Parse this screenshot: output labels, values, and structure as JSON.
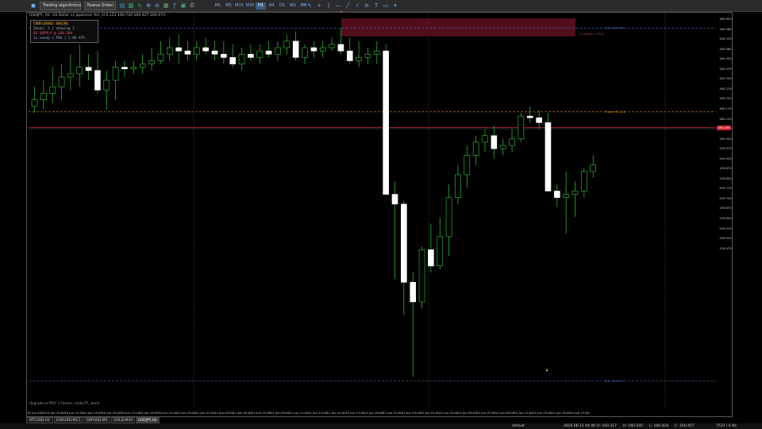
{
  "toolbar": {
    "algo_trading_label": "Trading algorítmico",
    "new_order_label": "Nueva Orden",
    "timeframes": [
      "M1",
      "M5",
      "M15",
      "M30",
      "H1",
      "H4",
      "D1",
      "W1",
      "MN"
    ],
    "active_timeframe": "H1"
  },
  "chart": {
    "title": "USDJPY, H1:  US Dollar vs Japanese Yen  ,H 0.123  160.726  160.427  160.473",
    "panel": {
      "title": "CONFLUENCE ENGINE",
      "zones": "Zones: 3 | showing 1",
      "active": "01 SUPPLY @ 160.584",
      "sweep": "   1x sweep + POH | 1.86 ATR"
    },
    "zone_label": "1x sweep + POH",
    "line_labels": {
      "top": "PDH 160.600",
      "mid": "Pivot 160.343",
      "bottom": "PDL 159.517"
    },
    "upgrade_text": "Upgrade to PRO: 5 factors, multi-TF, alerts",
    "current_price": "160.295",
    "price_labels": [
      "160.630",
      "160.580",
      "160.530",
      "160.480",
      "160.430",
      "160.370",
      "160.320",
      "160.270",
      "160.220",
      "160.170",
      "160.120",
      "160.070",
      "160.020",
      "159.970",
      "159.920",
      "159.870",
      "159.820",
      "159.770",
      "159.720",
      "159.670",
      "159.620",
      "159.570",
      "159.520",
      "159.470"
    ],
    "time_labels": [
      "10 Jun 2026",
      "10 Jun 10:00",
      "10 Jun 11:00",
      "10 Jun 13:00",
      "10 Jun 15:00",
      "10 Jun 17:00",
      "10 Jun 19:00",
      "10 Jun 21:00",
      "10 Jun 23:00",
      "11 Jun 01:00",
      "11 Jun 03:00",
      "11 Jun 05:00",
      "11 Jun 07:00",
      "11 Jun 09:00",
      "11 Jun 11:00",
      "11 Jun 13:00",
      "11 Jun 15:00",
      "11 Jun 17:00",
      "11 Jun 19:00",
      "11 Jun 21:00",
      "11 Jun 23:00",
      "12 Jun 01:00",
      "12 Jun 03:00",
      "12 Jun 05:00",
      "12 Jun 07:00",
      "12 Jun 09:00",
      "12 Jun 11:00",
      "12 Jun 13:00",
      "12 Jun 15:00",
      "12 Jun 17:00"
    ]
  },
  "tabs": [
    "BTCUSD,H1",
    "EURUSD,M15",
    "GBPUSD,M5",
    "GOLD,M30",
    "USDJPY,H1"
  ],
  "active_tab": "USDJPY,H1",
  "status": {
    "profile": "default",
    "datetime": "2026.06.11 04:00",
    "open": "O: 160.317",
    "high": "H: 160.545",
    "low": "L: 160.424",
    "close": "C: 160.457",
    "traffic": "7537 / 6 Kb"
  },
  "colors": {
    "bull": "#000000",
    "bear": "#ffffff",
    "wick": "#33cc33",
    "zone": "#5a0f1e",
    "level_top": "#4a6fb5",
    "level_mid": "#d88a1a",
    "level_price": "#cc2233"
  },
  "chart_data": {
    "type": "candlestick",
    "ylim": [
      159.46,
      160.64
    ],
    "candles": [
      {
        "o": 160.36,
        "h": 160.42,
        "l": 160.34,
        "c": 160.38
      },
      {
        "o": 160.38,
        "h": 160.44,
        "l": 160.35,
        "c": 160.4
      },
      {
        "o": 160.4,
        "h": 160.48,
        "l": 160.37,
        "c": 160.42
      },
      {
        "o": 160.42,
        "h": 160.49,
        "l": 160.38,
        "c": 160.45
      },
      {
        "o": 160.45,
        "h": 160.52,
        "l": 160.41,
        "c": 160.46
      },
      {
        "o": 160.46,
        "h": 160.55,
        "l": 160.42,
        "c": 160.48
      },
      {
        "o": 160.48,
        "h": 160.52,
        "l": 160.44,
        "c": 160.47
      },
      {
        "o": 160.47,
        "h": 160.53,
        "l": 160.4,
        "c": 160.41
      },
      {
        "o": 160.41,
        "h": 160.47,
        "l": 160.35,
        "c": 160.44
      },
      {
        "o": 160.44,
        "h": 160.5,
        "l": 160.38,
        "c": 160.48
      },
      {
        "o": 160.48,
        "h": 160.5,
        "l": 160.45,
        "c": 160.475
      },
      {
        "o": 160.475,
        "h": 160.5,
        "l": 160.46,
        "c": 160.48
      },
      {
        "o": 160.48,
        "h": 160.52,
        "l": 160.46,
        "c": 160.49
      },
      {
        "o": 160.49,
        "h": 160.54,
        "l": 160.47,
        "c": 160.5
      },
      {
        "o": 160.5,
        "h": 160.56,
        "l": 160.49,
        "c": 160.52
      },
      {
        "o": 160.52,
        "h": 160.57,
        "l": 160.5,
        "c": 160.54
      },
      {
        "o": 160.54,
        "h": 160.58,
        "l": 160.49,
        "c": 160.53
      },
      {
        "o": 160.53,
        "h": 160.56,
        "l": 160.5,
        "c": 160.52
      },
      {
        "o": 160.52,
        "h": 160.56,
        "l": 160.5,
        "c": 160.54
      },
      {
        "o": 160.54,
        "h": 160.57,
        "l": 160.52,
        "c": 160.53
      },
      {
        "o": 160.53,
        "h": 160.56,
        "l": 160.5,
        "c": 160.52
      },
      {
        "o": 160.52,
        "h": 160.56,
        "l": 160.49,
        "c": 160.51
      },
      {
        "o": 160.51,
        "h": 160.55,
        "l": 160.48,
        "c": 160.49
      },
      {
        "o": 160.49,
        "h": 160.54,
        "l": 160.47,
        "c": 160.52
      },
      {
        "o": 160.52,
        "h": 160.55,
        "l": 160.5,
        "c": 160.51
      },
      {
        "o": 160.51,
        "h": 160.55,
        "l": 160.49,
        "c": 160.53
      },
      {
        "o": 160.53,
        "h": 160.56,
        "l": 160.51,
        "c": 160.52
      },
      {
        "o": 160.52,
        "h": 160.56,
        "l": 160.5,
        "c": 160.54
      },
      {
        "o": 160.54,
        "h": 160.58,
        "l": 160.52,
        "c": 160.56
      },
      {
        "o": 160.56,
        "h": 160.59,
        "l": 160.5,
        "c": 160.51
      },
      {
        "o": 160.51,
        "h": 160.55,
        "l": 160.49,
        "c": 160.54
      },
      {
        "o": 160.54,
        "h": 160.56,
        "l": 160.51,
        "c": 160.53
      },
      {
        "o": 160.53,
        "h": 160.56,
        "l": 160.51,
        "c": 160.54
      },
      {
        "o": 160.54,
        "h": 160.57,
        "l": 160.53,
        "c": 160.55
      },
      {
        "o": 160.55,
        "h": 160.6,
        "l": 160.52,
        "c": 160.53
      },
      {
        "o": 160.53,
        "h": 160.57,
        "l": 160.49,
        "c": 160.5
      },
      {
        "o": 160.5,
        "h": 160.56,
        "l": 160.48,
        "c": 160.51
      },
      {
        "o": 160.51,
        "h": 160.54,
        "l": 160.49,
        "c": 160.52
      },
      {
        "o": 160.52,
        "h": 160.56,
        "l": 160.49,
        "c": 160.53
      },
      {
        "o": 160.53,
        "h": 160.55,
        "l": 160.23,
        "c": 160.09
      },
      {
        "o": 160.09,
        "h": 160.13,
        "l": 159.83,
        "c": 160.06
      },
      {
        "o": 160.06,
        "h": 160.07,
        "l": 159.72,
        "c": 159.82
      },
      {
        "o": 159.82,
        "h": 159.85,
        "l": 159.53,
        "c": 159.76
      },
      {
        "o": 159.76,
        "h": 159.93,
        "l": 159.74,
        "c": 159.92
      },
      {
        "o": 159.92,
        "h": 160.0,
        "l": 159.85,
        "c": 159.87
      },
      {
        "o": 159.87,
        "h": 160.02,
        "l": 159.86,
        "c": 159.96
      },
      {
        "o": 159.96,
        "h": 160.12,
        "l": 159.9,
        "c": 160.08
      },
      {
        "o": 160.08,
        "h": 160.18,
        "l": 160.06,
        "c": 160.15
      },
      {
        "o": 160.15,
        "h": 160.24,
        "l": 160.11,
        "c": 160.21
      },
      {
        "o": 160.21,
        "h": 160.27,
        "l": 160.18,
        "c": 160.25
      },
      {
        "o": 160.25,
        "h": 160.29,
        "l": 160.22,
        "c": 160.27
      },
      {
        "o": 160.27,
        "h": 160.3,
        "l": 160.2,
        "c": 160.23
      },
      {
        "o": 160.23,
        "h": 160.26,
        "l": 160.21,
        "c": 160.24
      },
      {
        "o": 160.24,
        "h": 160.29,
        "l": 160.22,
        "c": 160.26
      },
      {
        "o": 160.26,
        "h": 160.34,
        "l": 160.25,
        "c": 160.33
      },
      {
        "o": 160.33,
        "h": 160.36,
        "l": 160.31,
        "c": 160.325
      },
      {
        "o": 160.325,
        "h": 160.35,
        "l": 160.29,
        "c": 160.31
      },
      {
        "o": 160.31,
        "h": 160.34,
        "l": 160.19,
        "c": 160.1
      },
      {
        "o": 160.1,
        "h": 160.12,
        "l": 160.05,
        "c": 160.08
      },
      {
        "o": 160.08,
        "h": 160.16,
        "l": 159.97,
        "c": 160.09
      },
      {
        "o": 160.09,
        "h": 160.13,
        "l": 160.02,
        "c": 160.1
      },
      {
        "o": 160.1,
        "h": 160.17,
        "l": 160.08,
        "c": 160.16
      },
      {
        "o": 160.16,
        "h": 160.21,
        "l": 160.14,
        "c": 160.18
      }
    ],
    "levels": {
      "pdh": 160.6,
      "pivot": 160.343,
      "price": 160.295,
      "pdl": 159.517
    },
    "zone": {
      "top": 160.63,
      "bottom": 160.575
    }
  }
}
